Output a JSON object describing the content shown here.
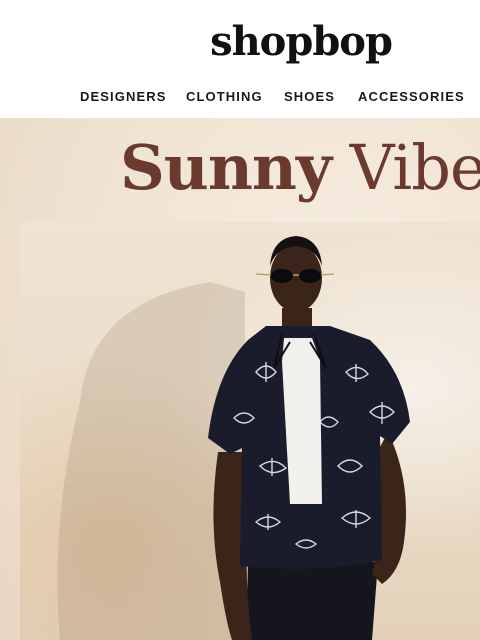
{
  "brand": {
    "logo_text": "shopbop"
  },
  "nav": {
    "items": [
      {
        "label": "DESIGNERS"
      },
      {
        "label": "CLOTHING"
      },
      {
        "label": "SHOES"
      },
      {
        "label": "ACCESSORIES"
      }
    ]
  },
  "hero": {
    "headline_bold": "Sunny",
    "headline_thin": "Vibes"
  },
  "colors": {
    "headline": "#6b3a2e",
    "background": "#efe2d1",
    "text": "#1a1a1a"
  }
}
